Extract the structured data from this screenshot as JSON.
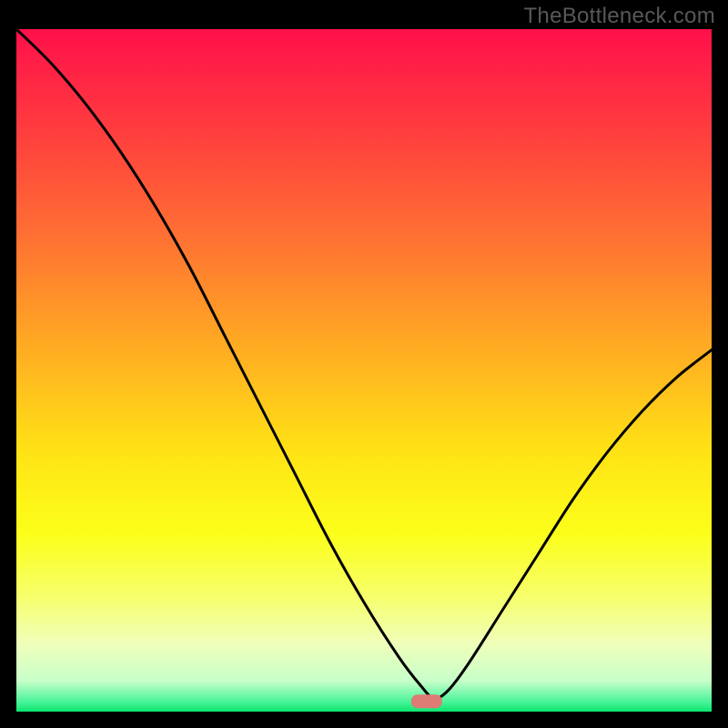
{
  "watermark": "TheBottleneck.com",
  "chart_data": {
    "type": "line",
    "title": "",
    "xlabel": "",
    "ylabel": "",
    "xlim": [
      0,
      100
    ],
    "ylim": [
      0,
      100
    ],
    "series": [
      {
        "name": "curve",
        "x": [
          0,
          5,
          10,
          15,
          20,
          25,
          30,
          35,
          40,
          45,
          50,
          55,
          58,
          60,
          62,
          65,
          70,
          75,
          80,
          85,
          90,
          95,
          100
        ],
        "values": [
          100,
          95,
          89,
          82,
          74,
          65,
          55,
          45,
          35,
          25,
          16,
          8,
          4,
          2,
          3,
          7,
          15,
          23,
          31,
          38,
          44,
          49,
          53
        ]
      }
    ],
    "marker": {
      "x": 59,
      "y": 1.5,
      "color": "#dc7c75"
    },
    "gradient_stops": [
      {
        "pos": 0.0,
        "color": "#ff104a"
      },
      {
        "pos": 0.14,
        "color": "#ff3a3f"
      },
      {
        "pos": 0.3,
        "color": "#ff6f33"
      },
      {
        "pos": 0.47,
        "color": "#ffad22"
      },
      {
        "pos": 0.62,
        "color": "#ffe315"
      },
      {
        "pos": 0.74,
        "color": "#fcff1a"
      },
      {
        "pos": 0.83,
        "color": "#f6ff6a"
      },
      {
        "pos": 0.9,
        "color": "#f0ffba"
      },
      {
        "pos": 0.955,
        "color": "#c7ffc9"
      },
      {
        "pos": 0.985,
        "color": "#4bf49a"
      },
      {
        "pos": 1.0,
        "color": "#0ae66f"
      }
    ]
  }
}
